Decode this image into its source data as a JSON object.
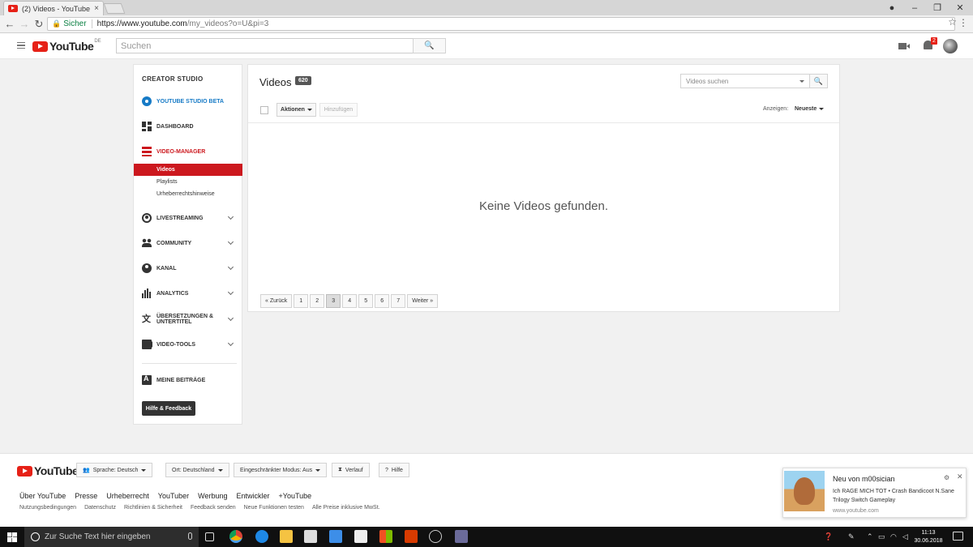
{
  "browser": {
    "tab_title": "(2) Videos - YouTube",
    "tab_close": "×",
    "secure_label": "Sicher",
    "url_host": "https://www.youtube.com",
    "url_path": "/my_videos?o=U&pi=3"
  },
  "masthead": {
    "logo_text": "YouTube",
    "logo_region": "DE",
    "search_placeholder": "Suchen",
    "notif_count": "2"
  },
  "sidebar": {
    "header": "CREATOR STUDIO",
    "items": [
      {
        "label": "YOUTUBE STUDIO BETA",
        "icon": "gear-icon"
      },
      {
        "label": "DASHBOARD",
        "icon": "dashboard-icon"
      },
      {
        "label": "VIDEO-MANAGER",
        "icon": "video-manager-icon"
      },
      {
        "label": "LIVESTREAMING",
        "icon": "livestream-icon"
      },
      {
        "label": "COMMUNITY",
        "icon": "community-icon"
      },
      {
        "label": "KANAL",
        "icon": "channel-icon"
      },
      {
        "label": "ANALYTICS",
        "icon": "analytics-icon"
      },
      {
        "label": "ÜBERSETZUNGEN & UNTERTITEL",
        "icon": "translate-icon"
      },
      {
        "label": "VIDEO-TOOLS",
        "icon": "video-tools-icon"
      },
      {
        "label": "MEINE BEITRÄGE",
        "icon": "contributions-icon"
      }
    ],
    "sub_items": [
      "Videos",
      "Playlists",
      "Urheberrechtshinweise"
    ],
    "help_button": "Hilfe & Feedback"
  },
  "main": {
    "title": "Videos",
    "count": "620",
    "search_placeholder": "Videos suchen",
    "actions_label": "Aktionen",
    "add_label": "Hinzufügen",
    "show_label": "Anzeigen:",
    "sort_value": "Neueste",
    "empty_message": "Keine Videos gefunden.",
    "pagination": {
      "prev": "« Zurück",
      "pages": [
        "1",
        "2",
        "3",
        "4",
        "5",
        "6",
        "7"
      ],
      "current": "3",
      "next": "Weiter »"
    }
  },
  "footer": {
    "language": "Sprache: Deutsch",
    "location": "Ort: Deutschland",
    "restricted_mode": "Eingeschränkter Modus: Aus",
    "history": "Verlauf",
    "help": "Hilfe",
    "links": [
      "Über YouTube",
      "Presse",
      "Urheberrecht",
      "YouTuber",
      "Werbung",
      "Entwickler",
      "+YouTube"
    ],
    "links2": [
      "Nutzungsbedingungen",
      "Datenschutz",
      "Richtlinien & Sicherheit",
      "Feedback senden",
      "Neue Funktionen testen",
      "Alle Preise inklusive MwSt."
    ]
  },
  "notification": {
    "title": "Neu von m00sician",
    "body": "Ich RAGE MICH TOT • Crash Bandicoot N.Sane Trilogy Switch Gameplay",
    "source": "www.youtube.com"
  },
  "taskbar": {
    "search_placeholder": "Zur Suche Text hier eingeben",
    "time": "11:13",
    "date": "30.06.2018"
  },
  "colors": {
    "brand_red": "#cc181e",
    "link_blue": "#167ac6"
  }
}
